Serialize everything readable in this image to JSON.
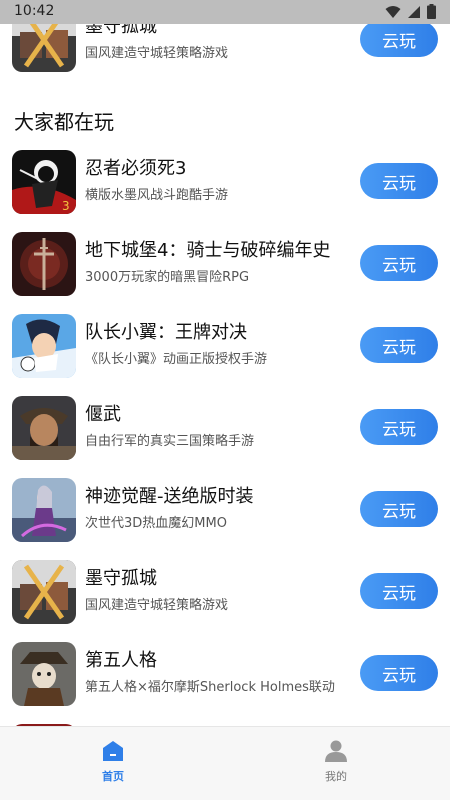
{
  "status_bar": {
    "time": "10:42"
  },
  "section": {
    "title": "大家都在玩"
  },
  "top_partial_game": {
    "name": "墨守孤城",
    "desc": "国风建造守城轻策略游戏",
    "button": "云玩"
  },
  "games": [
    {
      "name": "忍者必须死3",
      "desc": "横版水墨风战斗跑酷手游",
      "button": "云玩"
    },
    {
      "name": "地下城堡4：骑士与破碎编年史",
      "desc": "3000万玩家的暗黑冒险RPG",
      "button": "云玩"
    },
    {
      "name": "队长小翼：王牌对决",
      "desc": "《队长小翼》动画正版授权手游",
      "button": "云玩"
    },
    {
      "name": "偃武",
      "desc": "自由行军的真实三国策略手游",
      "button": "云玩"
    },
    {
      "name": "神迹觉醒-送绝版时装",
      "desc": "次世代3D热血魔幻MMO",
      "button": "云玩"
    },
    {
      "name": "墨守孤城",
      "desc": "国风建造守城轻策略游戏",
      "button": "云玩"
    },
    {
      "name": "第五人格",
      "desc": "第五人格×福尔摩斯Sherlock Holmes联动",
      "button": "云玩"
    }
  ],
  "tab_bar": {
    "home_label": "首页",
    "mine_label": "我的",
    "active_color": "#2f7fe8",
    "inactive_color": "#999999"
  },
  "accent_color": "#2f7fe8"
}
